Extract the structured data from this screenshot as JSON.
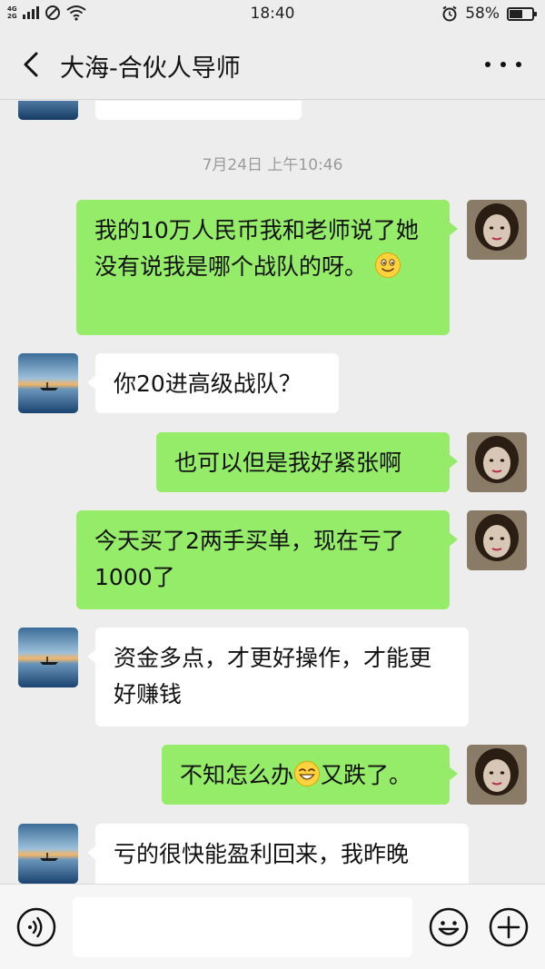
{
  "status_bar": {
    "network_top": "4G",
    "network_bottom": "2G",
    "time": "18:40",
    "battery_percent_label": "58%",
    "battery_level": 0.58
  },
  "header": {
    "title": "大海-合伙人导师"
  },
  "chat": {
    "timestamp": "7月24日 上午10:46",
    "messages": [
      {
        "from": "self",
        "text": "我的10万人民币我和老师说了她没有说我是哪个战队的呀。",
        "emoji": "slightly-smiling-emoji"
      },
      {
        "from": "other",
        "text": "你20进高级战队？"
      },
      {
        "from": "self",
        "text": "也可以但是我好紧张啊"
      },
      {
        "from": "self",
        "text": "今天买了2两手买单，现在亏了1000了"
      },
      {
        "from": "other",
        "text": "资金多点，才更好操作，才能更好赚钱"
      },
      {
        "from": "self",
        "text_before": "不知怎么办",
        "emoji": "grinning-emoji",
        "text_after": "又跌了。"
      },
      {
        "from": "other",
        "text": "亏的很快能盈利回来，我昨晚"
      }
    ]
  },
  "input_bar": {
    "placeholder": ""
  },
  "colors": {
    "background": "#ededed",
    "bubble_self": "#95ec69",
    "bubble_other": "#ffffff"
  }
}
